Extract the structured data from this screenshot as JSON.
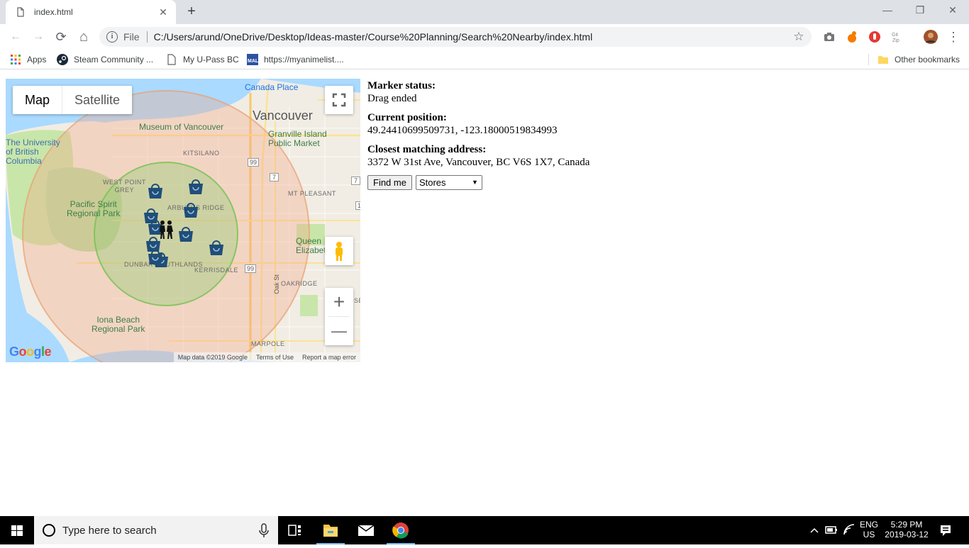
{
  "browser": {
    "tab_title": "index.html",
    "tab_close": "✕",
    "new_tab": "+",
    "window_controls": {
      "minimize": "—",
      "restore": "❐",
      "close": "✕"
    },
    "nav": {
      "back": "←",
      "forward": "→",
      "reload": "⟳",
      "home": "⌂"
    },
    "address": {
      "info": "i",
      "scheme_label": "File",
      "url": "C:/Users/arund/OneDrive/Desktop/Ideas-master/Course%20Planning/Search%20Nearby/index.html",
      "star": "☆"
    },
    "menu": "⋮",
    "bookmarks": [
      {
        "label": "Apps",
        "icon": "apps-grid-icon"
      },
      {
        "label": "Steam Community ...",
        "icon": "steam-icon"
      },
      {
        "label": "My U-Pass BC",
        "icon": "page-icon"
      },
      {
        "label": "https://myanimelist....",
        "icon": "mal-icon"
      }
    ],
    "other_bookmarks": "Other bookmarks"
  },
  "map": {
    "type_map": "Map",
    "type_satellite": "Satellite",
    "zoom_in": "+",
    "zoom_out": "—",
    "google_logo": "Google",
    "attribution": {
      "data": "Map data ©2019 Google",
      "terms": "Terms of Use",
      "report": "Report a map error"
    },
    "labels": {
      "vancouver": "Vancouver",
      "canada_place": "Canada Place",
      "museum": "Museum of Vancouver",
      "granville": "Granville Island\nPublic Market",
      "ubc": "The University\nof British\nColumbia",
      "kitsilano": "KITSILANO",
      "west_point_grey": "WEST POINT\nGREY",
      "pacific_spirit": "Pacific Spirit\nRegional Park",
      "arbutus": "ARBUTUS RIDGE",
      "mt_pleasant": "MT PLEASANT",
      "queen_elizabeth": "Queen\nElizabeth Pa",
      "dunbar": "DUNBAR-SOUTHLANDS",
      "kerrisdale": "KERRISDALE",
      "oakridge": "OAKRIDGE",
      "iona": "Iona Beach\nRegional Park",
      "marpole": "MARPOLE",
      "oak_st": "Oak St",
      "hwy99a": "99",
      "hwy99b": "99",
      "hwy7": "7",
      "hwy7b": "7",
      "hwy1": "1",
      "se": "SE"
    }
  },
  "info": {
    "marker_status_label": "Marker status:",
    "marker_status": "Drag ended",
    "position_label": "Current position:",
    "position": "49.24410699509731, -123.18000519834993",
    "address_label": "Closest matching address:",
    "address": "3372 W 31st Ave, Vancouver, BC V6S 1X7, Canada",
    "find_button": "Find me",
    "category_selected": "Stores"
  },
  "taskbar": {
    "search_placeholder": "Type here to search",
    "language": "ENG",
    "region": "US",
    "time": "5:29 PM",
    "date": "2019-03-12",
    "colors": {
      "taskbar": "#000000",
      "accent": "#76b9ed"
    }
  }
}
